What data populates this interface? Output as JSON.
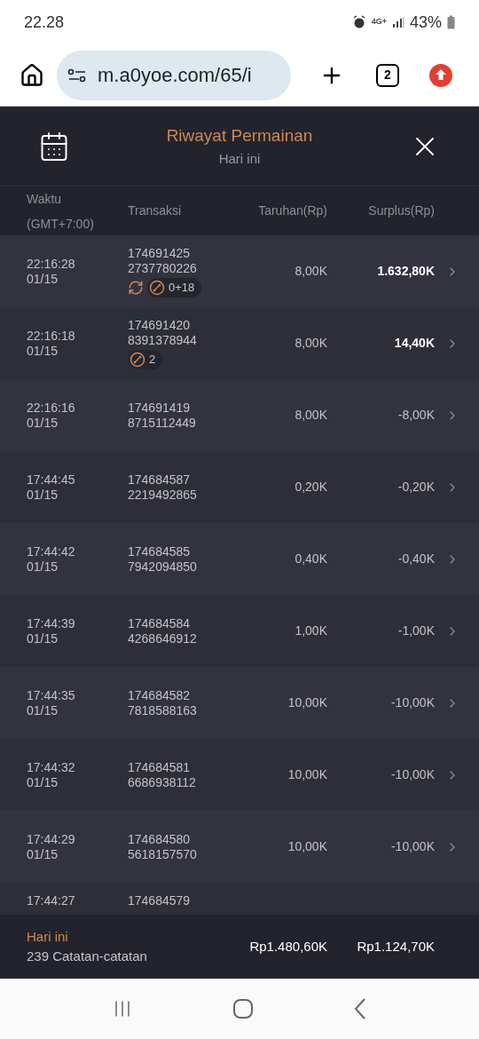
{
  "status_bar": {
    "time": "22.28",
    "network": "4G+",
    "battery": "43%"
  },
  "browser": {
    "url": "m.a0yoe.com/65/i",
    "tab_count": "2"
  },
  "header": {
    "title": "Riwayat Permainan",
    "subtitle": "Hari ini"
  },
  "table": {
    "columns": [
      {
        "label": "Waktu",
        "sub": "(GMT+7:00)"
      },
      {
        "label": "Transaksi"
      },
      {
        "label": "Taruhan(Rp)"
      },
      {
        "label": "Surplus(Rp)"
      }
    ],
    "rows": [
      {
        "time": "22:16:28",
        "date": "01/15",
        "id_1": "174691425",
        "id_2": "2737780226",
        "bet": "8,00K",
        "surplus": "1.632,80K",
        "win": true,
        "tags": [
          {
            "kind": "respin"
          },
          {
            "kind": "combo",
            "text": "0+18"
          }
        ]
      },
      {
        "time": "22:16:18",
        "date": "01/15",
        "id_1": "174691420",
        "id_2": "8391378944",
        "bet": "8,00K",
        "surplus": "14,40K",
        "win": true,
        "tags": [
          {
            "kind": "combo",
            "text": "2"
          }
        ]
      },
      {
        "time": "22:16:16",
        "date": "01/15",
        "id_1": "174691419",
        "id_2": "8715112449",
        "bet": "8,00K",
        "surplus": "-8,00K",
        "win": false,
        "tags": []
      },
      {
        "time": "17:44:45",
        "date": "01/15",
        "id_1": "174684587",
        "id_2": "2219492865",
        "bet": "0,20K",
        "surplus": "-0,20K",
        "win": false,
        "tags": []
      },
      {
        "time": "17:44:42",
        "date": "01/15",
        "id_1": "174684585",
        "id_2": "7942094850",
        "bet": "0,40K",
        "surplus": "-0,40K",
        "win": false,
        "tags": []
      },
      {
        "time": "17:44:39",
        "date": "01/15",
        "id_1": "174684584",
        "id_2": "4268646912",
        "bet": "1,00K",
        "surplus": "-1,00K",
        "win": false,
        "tags": []
      },
      {
        "time": "17:44:35",
        "date": "01/15",
        "id_1": "174684582",
        "id_2": "7818588163",
        "bet": "10,00K",
        "surplus": "-10,00K",
        "win": false,
        "tags": []
      },
      {
        "time": "17:44:32",
        "date": "01/15",
        "id_1": "174684581",
        "id_2": "6686938112",
        "bet": "10,00K",
        "surplus": "-10,00K",
        "win": false,
        "tags": []
      },
      {
        "time": "17:44:29",
        "date": "01/15",
        "id_1": "174684580",
        "id_2": "5618157570",
        "bet": "10,00K",
        "surplus": "-10,00K",
        "win": false,
        "tags": []
      },
      {
        "time": "17:44:27",
        "id_1": "174684579",
        "tags": []
      }
    ]
  },
  "footer": {
    "period": "Hari ini",
    "count": "239 Catatan-catatan",
    "total_bet": "Rp1.480,60K",
    "total_surplus": "Rp1.124,70K"
  }
}
